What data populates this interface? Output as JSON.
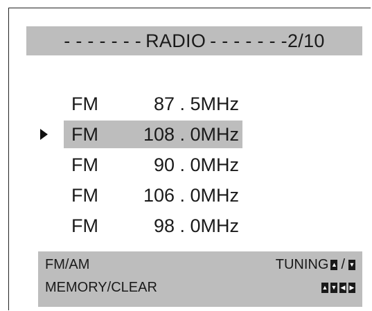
{
  "header": {
    "dashes_left": "- - - - - - -",
    "title": "RADIO",
    "dashes_right": "- - - - - - -",
    "page": "2/10"
  },
  "presets": [
    {
      "band": "FM",
      "freq": "87 . 5MHz",
      "selected": false
    },
    {
      "band": "FM",
      "freq": "108 . 0MHz",
      "selected": true
    },
    {
      "band": "FM",
      "freq": "90 . 0MHz",
      "selected": false
    },
    {
      "band": "FM",
      "freq": "106 . 0MHz",
      "selected": false
    },
    {
      "band": "FM",
      "freq": "98 . 0MHz",
      "selected": false
    }
  ],
  "footer": {
    "band_switch_label": "FM/AM",
    "tuning_label": "TUNING",
    "tuning_separator": "/",
    "memory_label": "MEMORY/CLEAR"
  },
  "icons": {
    "up": "arrow-up-icon",
    "down": "arrow-down-icon",
    "left": "arrow-left-icon",
    "right": "arrow-right-icon"
  },
  "colors": {
    "highlight": "#bdbdbd",
    "text": "#1a1a1a"
  }
}
